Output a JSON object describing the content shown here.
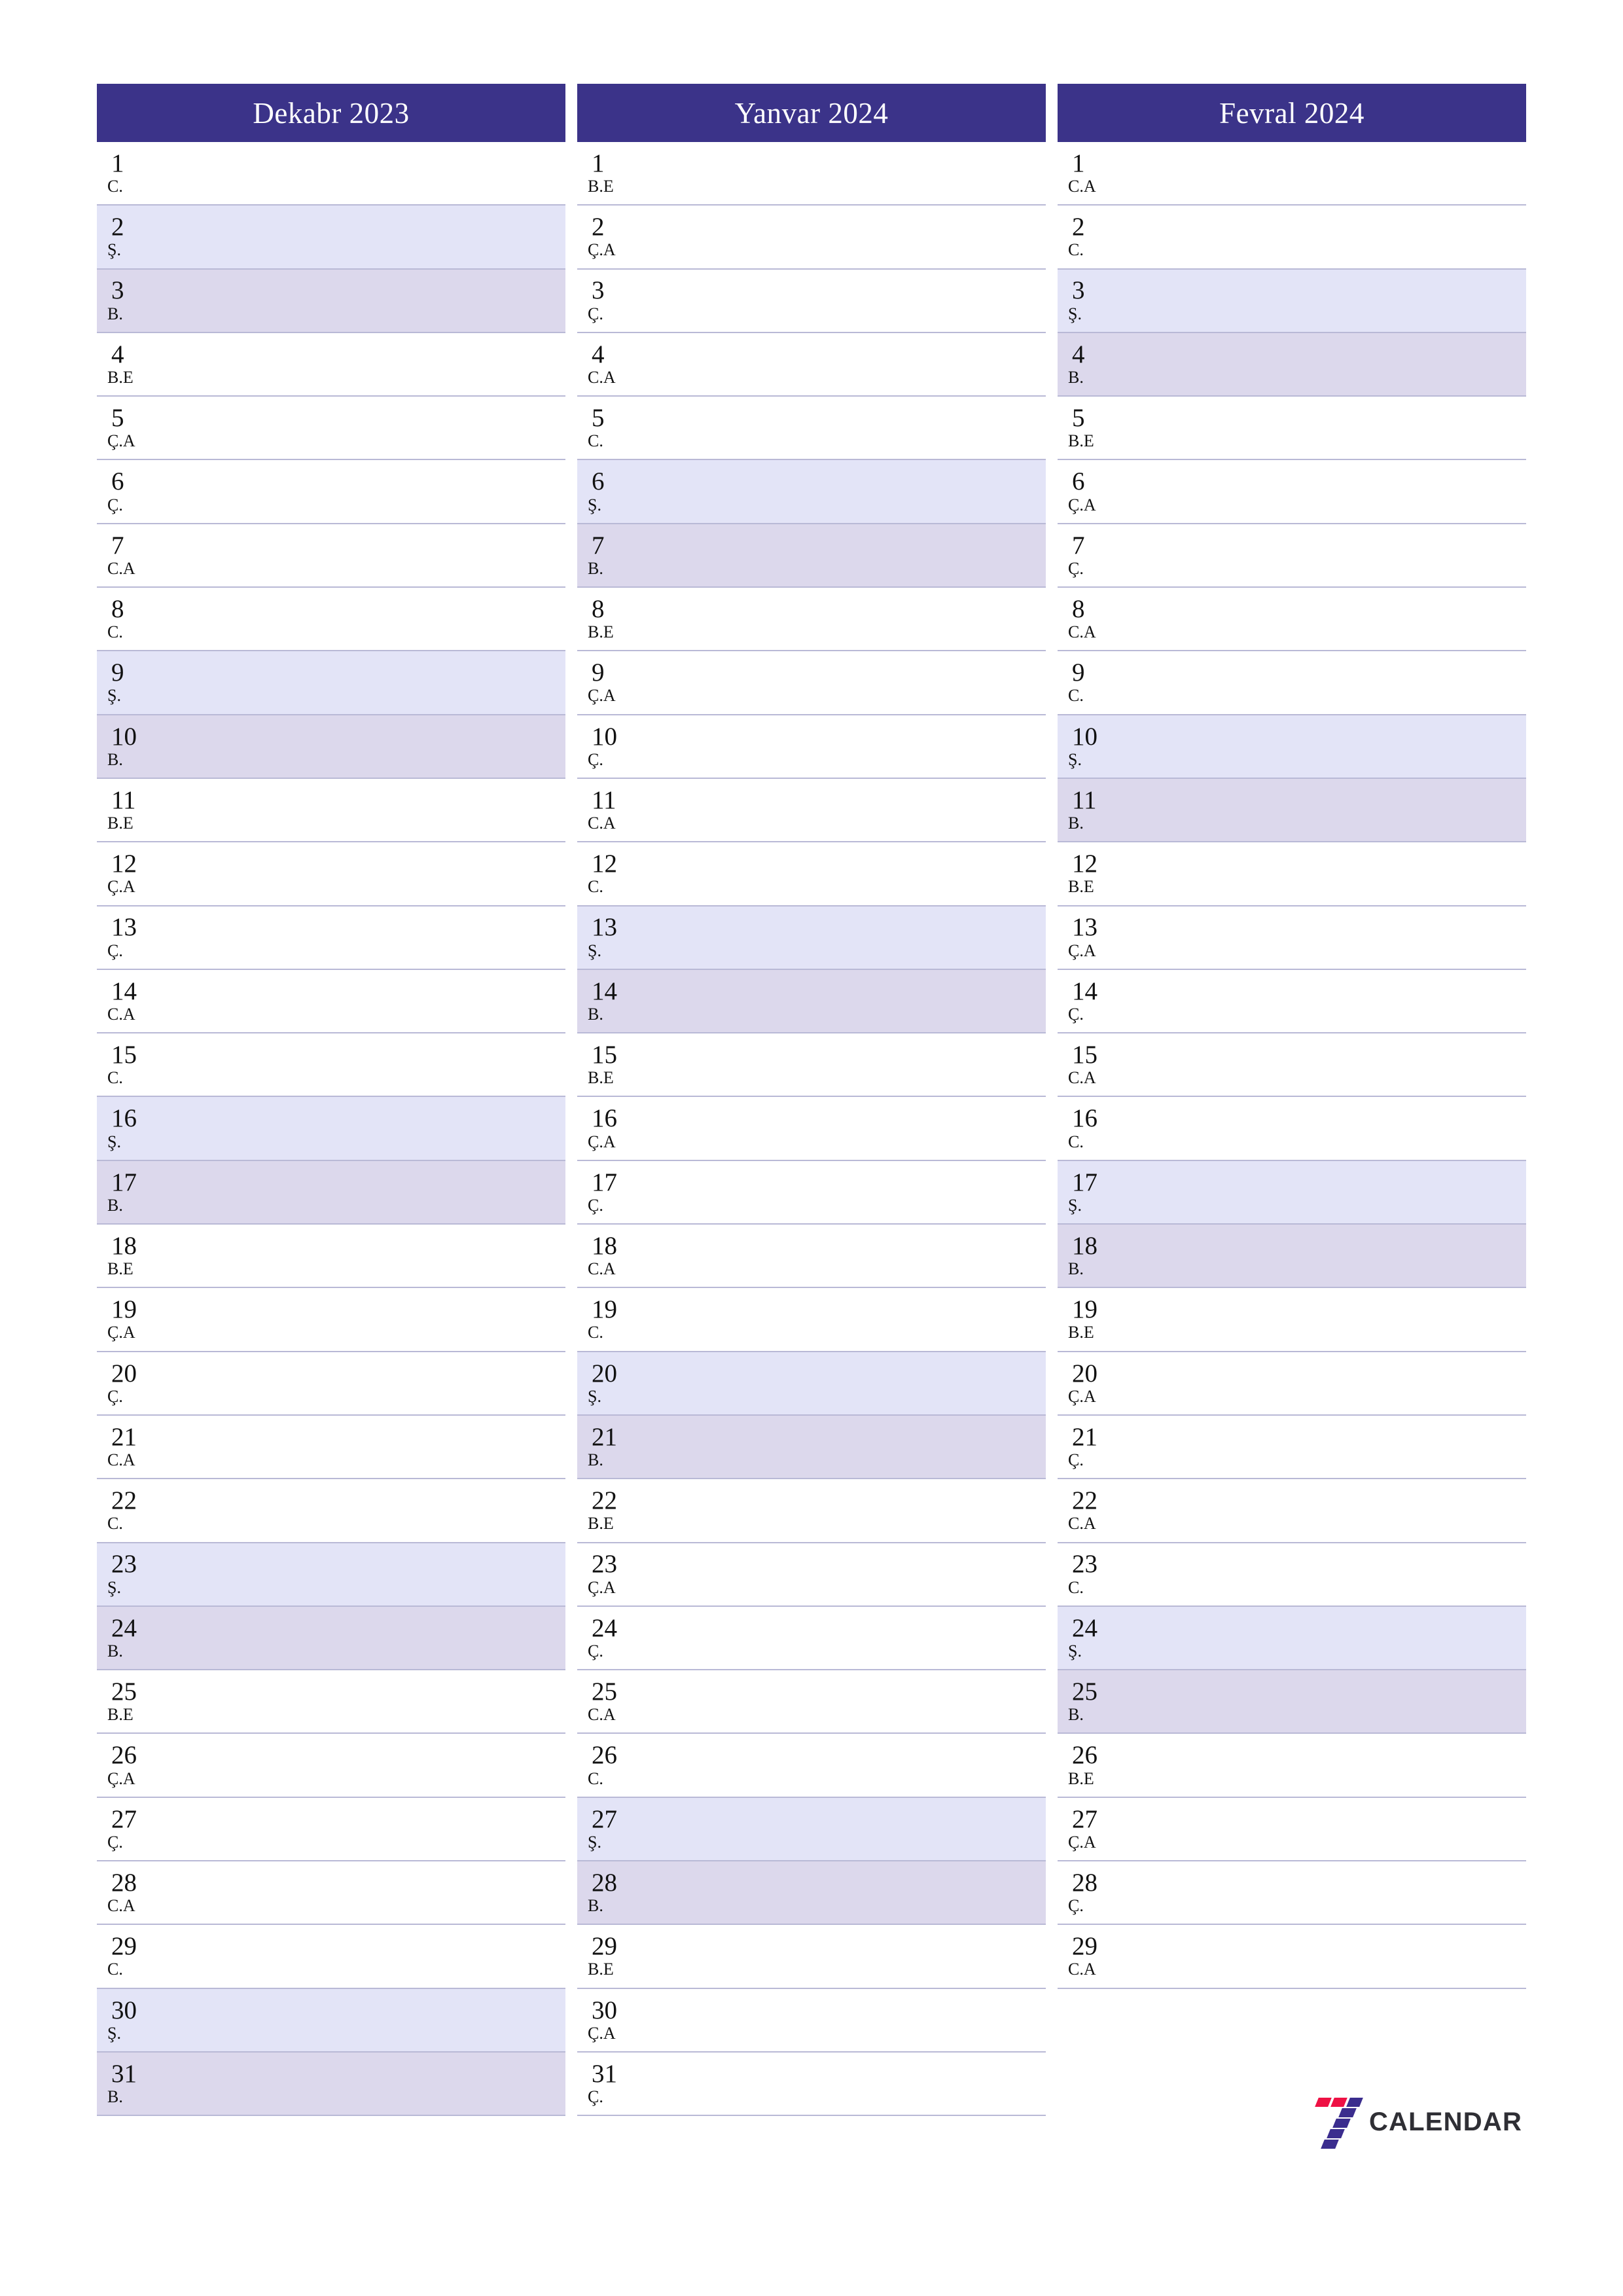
{
  "document": {
    "type": "three-month-planner",
    "orientation": "portrait",
    "language": "az"
  },
  "theme": {
    "header_bg": "#3b3389",
    "header_text": "#ffffff",
    "saturday_bg": "#e3e4f7",
    "sunday_bg": "#dcd8ec",
    "row_divider": "#b9b9d6",
    "day_text": "#111111",
    "logo_red": "#ee1144",
    "logo_indigo": "#3b2d8e",
    "logo_word_color": "#2f2f35"
  },
  "weekday_codes": {
    "monday": "B.E",
    "tuesday": "Ç.A",
    "wednesday": "Ç.",
    "thursday": "C.A",
    "friday": "C.",
    "saturday": "Ş.",
    "sunday": "B."
  },
  "months": [
    {
      "title": "Dekabr 2023",
      "days": [
        {
          "n": "1",
          "wd": "C.",
          "type": "weekday"
        },
        {
          "n": "2",
          "wd": "Ş.",
          "type": "sat"
        },
        {
          "n": "3",
          "wd": "B.",
          "type": "sun"
        },
        {
          "n": "4",
          "wd": "B.E",
          "type": "weekday"
        },
        {
          "n": "5",
          "wd": "Ç.A",
          "type": "weekday"
        },
        {
          "n": "6",
          "wd": "Ç.",
          "type": "weekday"
        },
        {
          "n": "7",
          "wd": "C.A",
          "type": "weekday"
        },
        {
          "n": "8",
          "wd": "C.",
          "type": "weekday"
        },
        {
          "n": "9",
          "wd": "Ş.",
          "type": "sat"
        },
        {
          "n": "10",
          "wd": "B.",
          "type": "sun"
        },
        {
          "n": "11",
          "wd": "B.E",
          "type": "weekday"
        },
        {
          "n": "12",
          "wd": "Ç.A",
          "type": "weekday"
        },
        {
          "n": "13",
          "wd": "Ç.",
          "type": "weekday"
        },
        {
          "n": "14",
          "wd": "C.A",
          "type": "weekday"
        },
        {
          "n": "15",
          "wd": "C.",
          "type": "weekday"
        },
        {
          "n": "16",
          "wd": "Ş.",
          "type": "sat"
        },
        {
          "n": "17",
          "wd": "B.",
          "type": "sun"
        },
        {
          "n": "18",
          "wd": "B.E",
          "type": "weekday"
        },
        {
          "n": "19",
          "wd": "Ç.A",
          "type": "weekday"
        },
        {
          "n": "20",
          "wd": "Ç.",
          "type": "weekday"
        },
        {
          "n": "21",
          "wd": "C.A",
          "type": "weekday"
        },
        {
          "n": "22",
          "wd": "C.",
          "type": "weekday"
        },
        {
          "n": "23",
          "wd": "Ş.",
          "type": "sat"
        },
        {
          "n": "24",
          "wd": "B.",
          "type": "sun"
        },
        {
          "n": "25",
          "wd": "B.E",
          "type": "weekday"
        },
        {
          "n": "26",
          "wd": "Ç.A",
          "type": "weekday"
        },
        {
          "n": "27",
          "wd": "Ç.",
          "type": "weekday"
        },
        {
          "n": "28",
          "wd": "C.A",
          "type": "weekday"
        },
        {
          "n": "29",
          "wd": "C.",
          "type": "weekday"
        },
        {
          "n": "30",
          "wd": "Ş.",
          "type": "sat"
        },
        {
          "n": "31",
          "wd": "B.",
          "type": "sun"
        }
      ]
    },
    {
      "title": "Yanvar 2024",
      "days": [
        {
          "n": "1",
          "wd": "B.E",
          "type": "weekday"
        },
        {
          "n": "2",
          "wd": "Ç.A",
          "type": "weekday"
        },
        {
          "n": "3",
          "wd": "Ç.",
          "type": "weekday"
        },
        {
          "n": "4",
          "wd": "C.A",
          "type": "weekday"
        },
        {
          "n": "5",
          "wd": "C.",
          "type": "weekday"
        },
        {
          "n": "6",
          "wd": "Ş.",
          "type": "sat"
        },
        {
          "n": "7",
          "wd": "B.",
          "type": "sun"
        },
        {
          "n": "8",
          "wd": "B.E",
          "type": "weekday"
        },
        {
          "n": "9",
          "wd": "Ç.A",
          "type": "weekday"
        },
        {
          "n": "10",
          "wd": "Ç.",
          "type": "weekday"
        },
        {
          "n": "11",
          "wd": "C.A",
          "type": "weekday"
        },
        {
          "n": "12",
          "wd": "C.",
          "type": "weekday"
        },
        {
          "n": "13",
          "wd": "Ş.",
          "type": "sat"
        },
        {
          "n": "14",
          "wd": "B.",
          "type": "sun"
        },
        {
          "n": "15",
          "wd": "B.E",
          "type": "weekday"
        },
        {
          "n": "16",
          "wd": "Ç.A",
          "type": "weekday"
        },
        {
          "n": "17",
          "wd": "Ç.",
          "type": "weekday"
        },
        {
          "n": "18",
          "wd": "C.A",
          "type": "weekday"
        },
        {
          "n": "19",
          "wd": "C.",
          "type": "weekday"
        },
        {
          "n": "20",
          "wd": "Ş.",
          "type": "sat"
        },
        {
          "n": "21",
          "wd": "B.",
          "type": "sun"
        },
        {
          "n": "22",
          "wd": "B.E",
          "type": "weekday"
        },
        {
          "n": "23",
          "wd": "Ç.A",
          "type": "weekday"
        },
        {
          "n": "24",
          "wd": "Ç.",
          "type": "weekday"
        },
        {
          "n": "25",
          "wd": "C.A",
          "type": "weekday"
        },
        {
          "n": "26",
          "wd": "C.",
          "type": "weekday"
        },
        {
          "n": "27",
          "wd": "Ş.",
          "type": "sat"
        },
        {
          "n": "28",
          "wd": "B.",
          "type": "sun"
        },
        {
          "n": "29",
          "wd": "B.E",
          "type": "weekday"
        },
        {
          "n": "30",
          "wd": "Ç.A",
          "type": "weekday"
        },
        {
          "n": "31",
          "wd": "Ç.",
          "type": "weekday"
        }
      ]
    },
    {
      "title": "Fevral 2024",
      "days": [
        {
          "n": "1",
          "wd": "C.A",
          "type": "weekday"
        },
        {
          "n": "2",
          "wd": "C.",
          "type": "weekday"
        },
        {
          "n": "3",
          "wd": "Ş.",
          "type": "sat"
        },
        {
          "n": "4",
          "wd": "B.",
          "type": "sun"
        },
        {
          "n": "5",
          "wd": "B.E",
          "type": "weekday"
        },
        {
          "n": "6",
          "wd": "Ç.A",
          "type": "weekday"
        },
        {
          "n": "7",
          "wd": "Ç.",
          "type": "weekday"
        },
        {
          "n": "8",
          "wd": "C.A",
          "type": "weekday"
        },
        {
          "n": "9",
          "wd": "C.",
          "type": "weekday"
        },
        {
          "n": "10",
          "wd": "Ş.",
          "type": "sat"
        },
        {
          "n": "11",
          "wd": "B.",
          "type": "sun"
        },
        {
          "n": "12",
          "wd": "B.E",
          "type": "weekday"
        },
        {
          "n": "13",
          "wd": "Ç.A",
          "type": "weekday"
        },
        {
          "n": "14",
          "wd": "Ç.",
          "type": "weekday"
        },
        {
          "n": "15",
          "wd": "C.A",
          "type": "weekday"
        },
        {
          "n": "16",
          "wd": "C.",
          "type": "weekday"
        },
        {
          "n": "17",
          "wd": "Ş.",
          "type": "sat"
        },
        {
          "n": "18",
          "wd": "B.",
          "type": "sun"
        },
        {
          "n": "19",
          "wd": "B.E",
          "type": "weekday"
        },
        {
          "n": "20",
          "wd": "Ç.A",
          "type": "weekday"
        },
        {
          "n": "21",
          "wd": "Ç.",
          "type": "weekday"
        },
        {
          "n": "22",
          "wd": "C.A",
          "type": "weekday"
        },
        {
          "n": "23",
          "wd": "C.",
          "type": "weekday"
        },
        {
          "n": "24",
          "wd": "Ş.",
          "type": "sat"
        },
        {
          "n": "25",
          "wd": "B.",
          "type": "sun"
        },
        {
          "n": "26",
          "wd": "B.E",
          "type": "weekday"
        },
        {
          "n": "27",
          "wd": "Ç.A",
          "type": "weekday"
        },
        {
          "n": "28",
          "wd": "Ç.",
          "type": "weekday"
        },
        {
          "n": "29",
          "wd": "C.A",
          "type": "weekday"
        }
      ]
    }
  ],
  "logo": {
    "mark_name": "seven-logo-icon",
    "wordmark": "CALENDAR"
  }
}
